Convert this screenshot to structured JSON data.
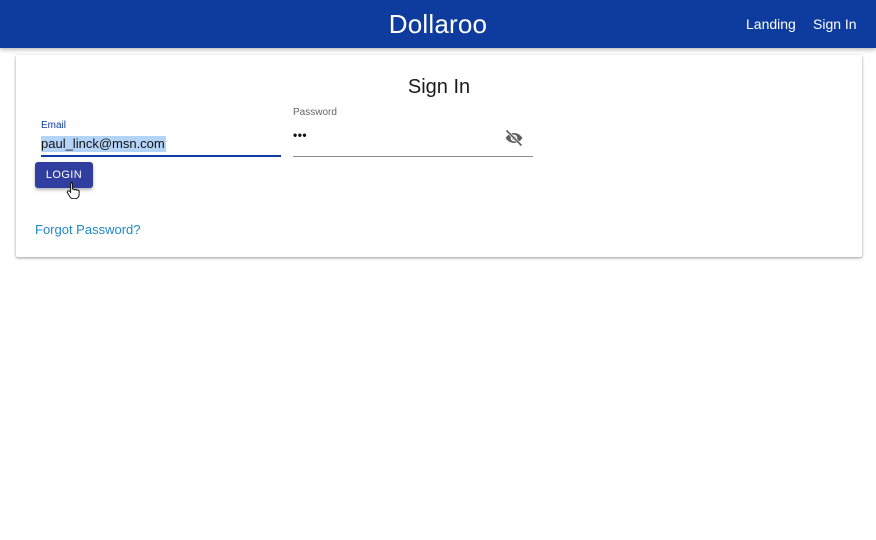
{
  "app": {
    "title": "Dollaroo",
    "nav": [
      {
        "label": "Landing"
      },
      {
        "label": "Sign In"
      }
    ]
  },
  "signin": {
    "title": "Sign In",
    "email": {
      "label": "Email",
      "value": "paul_linck@msn.com"
    },
    "password": {
      "label": "Password",
      "value": "•••",
      "toggle_icon": "eye-off-icon"
    },
    "login_label": "LOGIN",
    "forgot_label": "Forgot Password?"
  },
  "colors": {
    "appbar": "#0d3b9e",
    "button": "#303f9f",
    "link": "#1e88c9",
    "selection": "#b4d4f7"
  }
}
